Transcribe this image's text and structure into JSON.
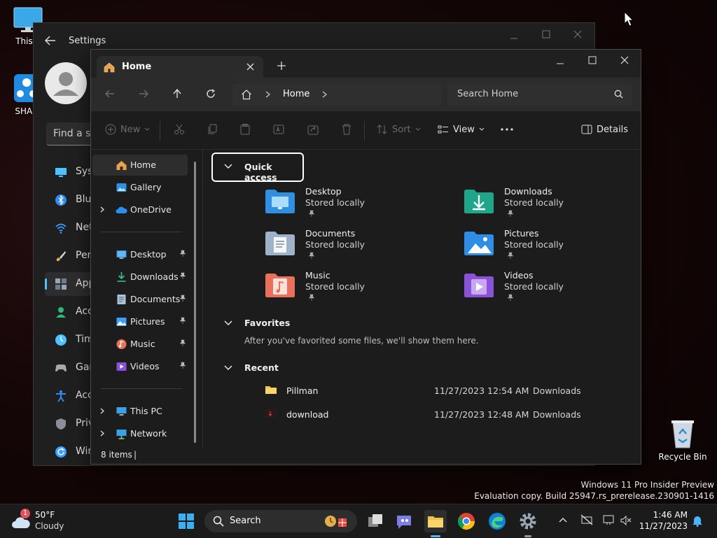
{
  "desktop": {
    "icons": [
      {
        "label": "This P",
        "icon": "monitor-icon"
      },
      {
        "label": "SHAR",
        "icon": "share-app-icon"
      },
      {
        "label": "Recycle Bin",
        "icon": "recycle-bin-icon"
      }
    ],
    "watermark": {
      "line1": "Windows 11 Pro Insider Preview",
      "line2": "Evaluation copy. Build 25947.rs_prerelease.230901-1416"
    }
  },
  "settings": {
    "title": "Settings",
    "search_placeholder": "Find a se",
    "nav": [
      {
        "label": "Syst",
        "icon": "system-icon",
        "color": "#4cc2ff"
      },
      {
        "label": "Blue",
        "icon": "bluetooth-icon",
        "color": "#2d8cf0"
      },
      {
        "label": "Net",
        "icon": "wifi-icon",
        "color": "#3aa0ff"
      },
      {
        "label": "Pers",
        "icon": "brush-icon",
        "color": "#e8a85b"
      },
      {
        "label": "App",
        "icon": "apps-icon",
        "color": "#9aa6b8"
      },
      {
        "label": "Acc",
        "icon": "accounts-icon",
        "color": "#2fb67c"
      },
      {
        "label": "Tim",
        "icon": "time-icon",
        "color": "#4cc2ff"
      },
      {
        "label": "Gar",
        "icon": "gaming-icon",
        "color": "#aaaaaa"
      },
      {
        "label": "Acc",
        "icon": "accessibility-icon",
        "color": "#2d8cf0"
      },
      {
        "label": "Priv",
        "icon": "shield-icon",
        "color": "#8a8f98"
      },
      {
        "label": "Win",
        "icon": "update-icon",
        "color": "#3aa0ff"
      }
    ]
  },
  "explorer": {
    "tab_title": "Home",
    "address": {
      "crumb": "Home",
      "search_placeholder": "Search Home"
    },
    "toolbar": {
      "new_label": "New",
      "sort_label": "Sort",
      "view_label": "View",
      "details_label": "Details"
    },
    "nav": {
      "top": [
        {
          "label": "Home",
          "icon": "home-icon"
        },
        {
          "label": "Gallery",
          "icon": "gallery-icon"
        },
        {
          "label": "OneDrive",
          "icon": "onedrive-icon"
        }
      ],
      "pinned": [
        {
          "label": "Desktop",
          "icon": "desktop-folder-icon"
        },
        {
          "label": "Downloads",
          "icon": "downloads-icon"
        },
        {
          "label": "Documents",
          "icon": "documents-icon"
        },
        {
          "label": "Pictures",
          "icon": "pictures-icon"
        },
        {
          "label": "Music",
          "icon": "music-icon"
        },
        {
          "label": "Videos",
          "icon": "videos-icon"
        }
      ],
      "bottom": [
        {
          "label": "This PC",
          "icon": "this-pc-icon"
        },
        {
          "label": "Network",
          "icon": "network-icon"
        }
      ]
    },
    "quick_access": {
      "heading": "Quick access",
      "items": [
        {
          "name": "Desktop",
          "sub": "Stored locally",
          "icon": "desktop-folder-icon",
          "color": "#2f8fe0"
        },
        {
          "name": "Downloads",
          "sub": "Stored locally",
          "icon": "downloads-folder-icon",
          "color": "#1fa58a"
        },
        {
          "name": "Documents",
          "sub": "Stored locally",
          "icon": "documents-folder-icon",
          "color": "#9fb3c8"
        },
        {
          "name": "Pictures",
          "sub": "Stored locally",
          "icon": "pictures-folder-icon",
          "color": "#2e8ee6"
        },
        {
          "name": "Music",
          "sub": "Stored locally",
          "icon": "music-folder-icon",
          "color": "#e9705a"
        },
        {
          "name": "Videos",
          "sub": "Stored locally",
          "icon": "videos-folder-icon",
          "color": "#8a52d8"
        }
      ]
    },
    "favorites": {
      "heading": "Favorites",
      "empty_text": "After you've favorited some files, we'll show them here."
    },
    "recent": {
      "heading": "Recent",
      "rows": [
        {
          "name": "Pillman",
          "date": "11/27/2023 12:54 AM",
          "location": "Downloads",
          "icon": "folder-icon"
        },
        {
          "name": "download",
          "date": "11/27/2023 12:48 AM",
          "location": "Downloads",
          "icon": "image-file-icon"
        }
      ]
    },
    "status": {
      "items_count": "8 items"
    }
  },
  "taskbar": {
    "weather": {
      "temp": "50°F",
      "condition": "Cloudy",
      "badge": "1"
    },
    "search_label": "Search",
    "clock": {
      "time": "1:46 AM",
      "date": "11/27/2023"
    }
  }
}
